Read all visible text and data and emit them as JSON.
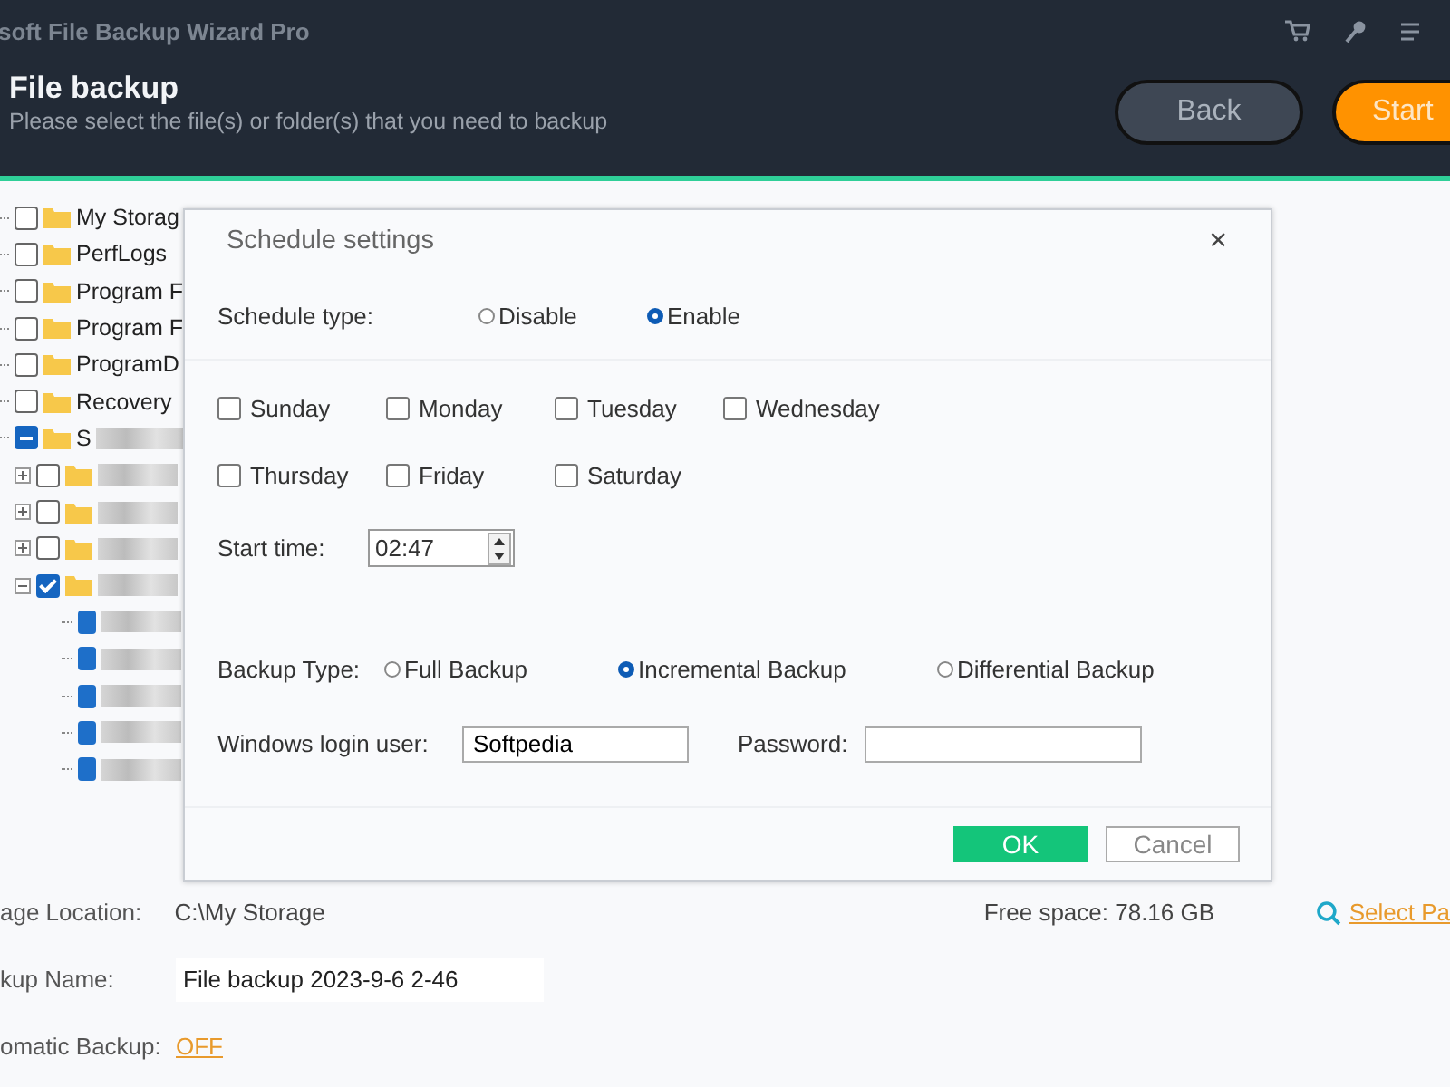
{
  "window": {
    "title": "soft File Backup Wizard Pro"
  },
  "header": {
    "title": "File backup",
    "subtitle": "Please select the file(s) or folder(s) that you need to backup",
    "buttons": [
      {
        "label": "Back",
        "kind": "secondary"
      },
      {
        "label": "Start",
        "kind": "primary"
      }
    ]
  },
  "tree": [
    {
      "label": "My Storag",
      "checked": false,
      "partial": false
    },
    {
      "label": "PerfLogs",
      "checked": false,
      "partial": false
    },
    {
      "label": "Program F",
      "checked": false,
      "partial": false
    },
    {
      "label": "Program F",
      "checked": false,
      "partial": false
    },
    {
      "label": "ProgramD",
      "checked": false,
      "partial": false
    },
    {
      "label": "Recovery",
      "checked": false,
      "partial": false
    },
    {
      "label": "S",
      "checked": true,
      "partial": true,
      "children": [
        {
          "checked": false,
          "expanded": false
        },
        {
          "checked": false,
          "expanded": false
        },
        {
          "checked": false,
          "expanded": false
        },
        {
          "checked": true,
          "expanded": true,
          "children": [
            {
              "checked": true
            },
            {
              "checked": true
            },
            {
              "checked": true
            },
            {
              "checked": true
            },
            {
              "checked": true
            }
          ]
        }
      ]
    }
  ],
  "dialog": {
    "title": "Schedule settings",
    "close": "×",
    "schedule_type": {
      "label": "Schedule type:",
      "options": [
        {
          "label": "Disable",
          "selected": false
        },
        {
          "label": "Enable",
          "selected": true
        }
      ]
    },
    "days": [
      {
        "label": "Sunday",
        "checked": false
      },
      {
        "label": "Monday",
        "checked": false
      },
      {
        "label": "Tuesday",
        "checked": false
      },
      {
        "label": "Wednesday",
        "checked": false
      },
      {
        "label": "Thursday",
        "checked": false
      },
      {
        "label": "Friday",
        "checked": false
      },
      {
        "label": "Saturday",
        "checked": false
      }
    ],
    "start_time": {
      "label": "Start time:",
      "value": "02:47"
    },
    "backup_type": {
      "label": "Backup Type:",
      "options": [
        {
          "label": "Full Backup",
          "selected": false
        },
        {
          "label": "Incremental Backup",
          "selected": true
        },
        {
          "label": "Differential Backup",
          "selected": false
        }
      ]
    },
    "login_user": {
      "label": "Windows login user:",
      "value": "Softpedia"
    },
    "password": {
      "label": "Password:"
    },
    "buttons": [
      {
        "label": "OK",
        "kind": "primary"
      },
      {
        "label": "Cancel",
        "kind": "secondary"
      }
    ]
  },
  "footer": {
    "storage_label": "age Location:",
    "storage_value": "C:\\My Storage",
    "free_space": "Free space: 78.16 GB",
    "select_link": "Select Pa",
    "name_label": "kup Name:",
    "name_value": "File backup 2023-9-6 2-46",
    "auto_label": "omatic Backup:",
    "auto_value": "OFF"
  }
}
